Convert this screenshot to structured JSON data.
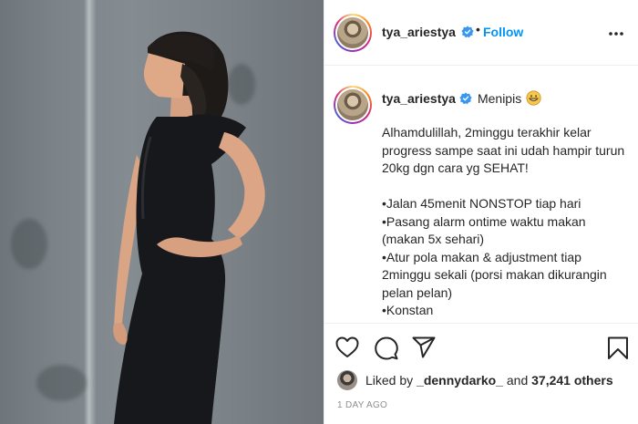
{
  "post": {
    "username": "tya_ariestya",
    "follow_label": "Follow",
    "separator": "•",
    "caption_title": "Menipis",
    "caption_body": "Alhamdulillah, 2minggu terakhir kelar progress sampe saat ini udah hampir turun 20kg dgn cara yg SEHAT!\n\n•Jalan 45menit NONSTOP tiap hari\n•Pasang alarm ontime waktu makan (makan 5x sehari)\n•Atur pola makan & adjustment tiap 2minggu sekali (porsi makan dikurangin pelan pelan)\n•Konstan",
    "liked_prefix": "Liked by ",
    "liked_user": "_dennydarko_",
    "liked_mid": " and ",
    "liked_count": "37,241 others",
    "timestamp": "1 DAY AGO"
  },
  "icons": {
    "verified": "verified-badge-icon",
    "more": "more-options-icon",
    "emoji": "grinning-emoji-icon",
    "like": "heart-icon",
    "comment": "comment-icon",
    "share": "paper-plane-icon",
    "save": "bookmark-icon"
  },
  "colors": {
    "accent": "#0095f6",
    "text": "#262626",
    "muted": "#8e8e8e",
    "divider": "#efefef",
    "dress": "#17181c"
  }
}
